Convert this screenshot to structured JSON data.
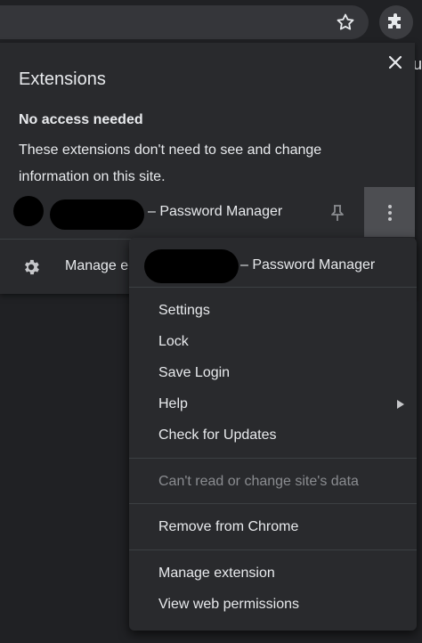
{
  "panel": {
    "title": "Extensions",
    "section_heading": "No access needed",
    "section_description": "These extensions don't need to see and change information on this site.",
    "extension_name_suffix": "– Password Manager",
    "manage_label": "Manage e"
  },
  "edge_text": "u",
  "menu": {
    "extension_name_suffix": "– Password Manager",
    "items": [
      {
        "label": "Settings"
      },
      {
        "label": "Lock"
      },
      {
        "label": "Save Login"
      },
      {
        "label": "Help"
      },
      {
        "label": "Check for Updates"
      },
      {
        "label": "Can't read or change site's data"
      },
      {
        "label": "Remove from Chrome"
      },
      {
        "label": "Manage extension"
      },
      {
        "label": "View web permissions"
      }
    ]
  },
  "icons": {
    "star": "star-icon",
    "extensions": "puzzle-icon",
    "close": "close-icon",
    "pin": "pin-icon",
    "more": "more-vertical-icon",
    "gear": "gear-icon",
    "submenu": "chevron-right-icon"
  },
  "colors": {
    "background": "#202124",
    "panel": "#292a2d",
    "text": "#e8eaed",
    "disabled_text": "#8a8c90",
    "highlight": "#4d4e52"
  }
}
